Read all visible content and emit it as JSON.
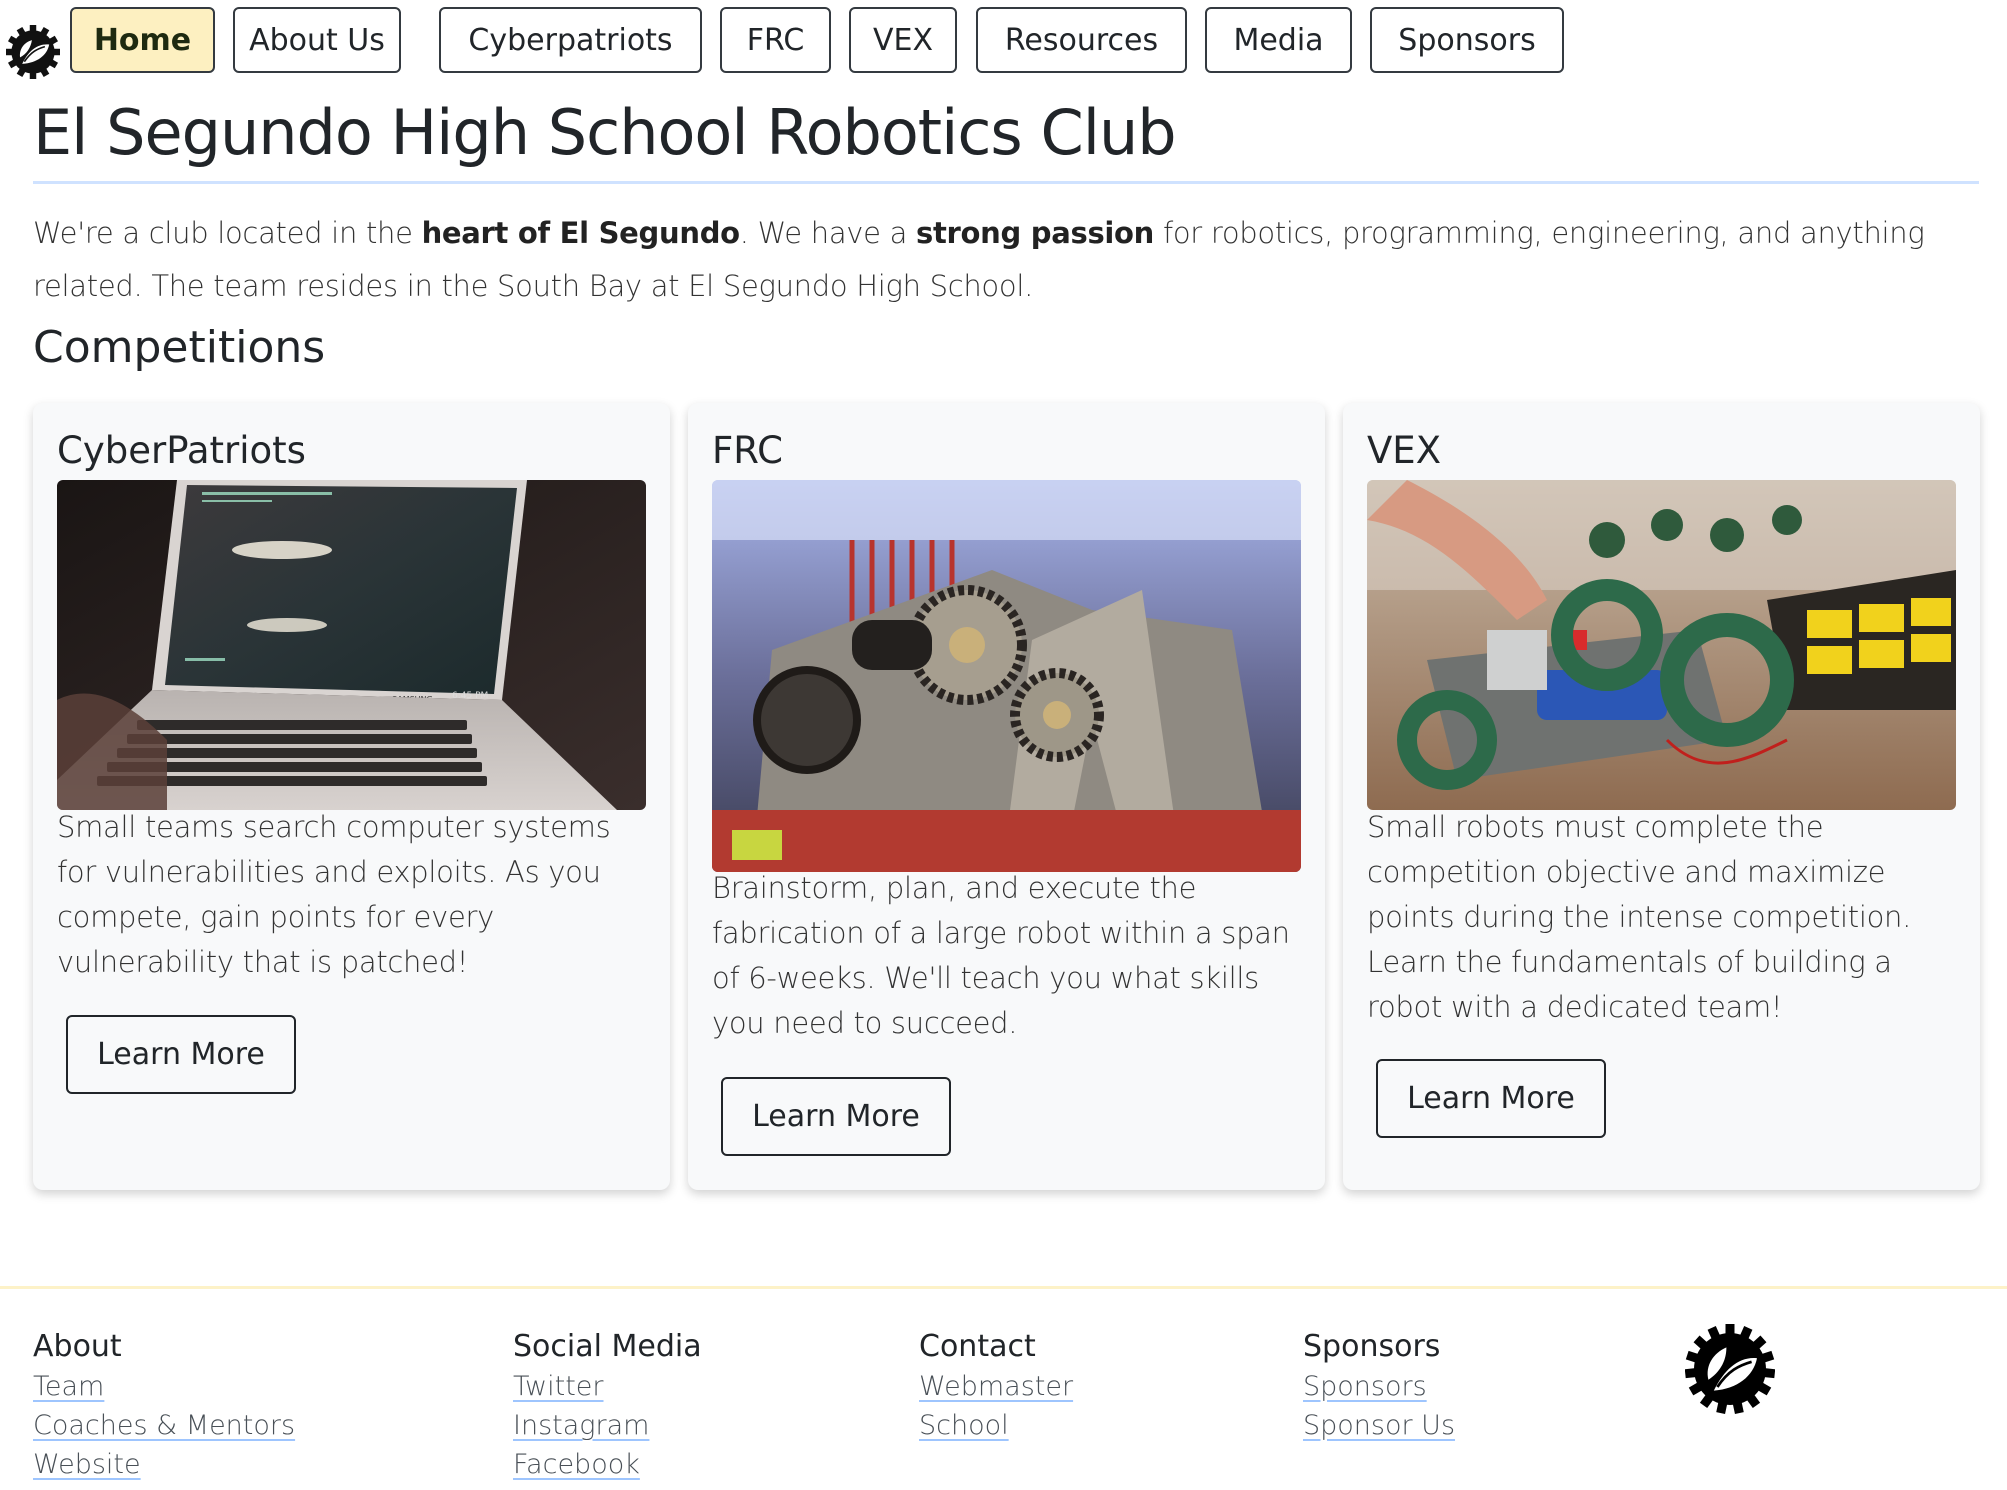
{
  "nav": {
    "logo_icon": "robotics-gear-leaf-logo-icon",
    "items": [
      {
        "label": "Home",
        "active": true
      },
      {
        "label": "About Us"
      },
      {
        "label": "Cyberpatriots"
      },
      {
        "label": "FRC"
      },
      {
        "label": "VEX"
      },
      {
        "label": "Resources"
      },
      {
        "label": "Media"
      },
      {
        "label": "Sponsors"
      }
    ]
  },
  "page": {
    "title": "El Segundo High School Robotics Club",
    "intro": {
      "p1": "We're a club located in the ",
      "b1": "heart of El Segundo",
      "p2": ". We have a ",
      "b2": "strong passion",
      "p3": " for robotics, programming, engineering, and anything related. The team resides in the South Bay at El Segundo High School."
    },
    "section_heading": "Competitions"
  },
  "cards": [
    {
      "title": "CyberPatriots",
      "image": "laptop-terminal-photo",
      "description": "Small teams search computer systems for vulnerabilities and exploits. As you compete, gain points for every vulnerability that is patched!",
      "button": "Learn More",
      "laptop_brand": "SAMSUNG",
      "screen_time": "6:45 PM"
    },
    {
      "title": "FRC",
      "image": "frc-robot-gears-photo",
      "description": "Brainstorm, plan, and execute the fabrication of a large robot within a span of 6-weeks. We'll teach you what skills you need to succeed.",
      "button": "Learn More"
    },
    {
      "title": "VEX",
      "image": "vex-robot-build-photo",
      "description": "Small robots must complete the competition objective and maximize points during the intense competition. Learn the fundamentals of building a robot with a dedicated team!",
      "button": "Learn More"
    }
  ],
  "footer": {
    "columns": [
      {
        "heading": "About",
        "links": [
          "Team",
          "Coaches & Mentors",
          "Website"
        ]
      },
      {
        "heading": "Social Media",
        "links": [
          "Twitter",
          "Instagram",
          "Facebook"
        ]
      },
      {
        "heading": "Contact",
        "links": [
          "Webmaster",
          "School"
        ]
      },
      {
        "heading": "Sponsors",
        "links": [
          "Sponsors",
          "Sponsor Us"
        ]
      }
    ],
    "logo_icon": "robotics-gear-leaf-logo-icon"
  },
  "colors": {
    "active_nav_bg": "#fdf0c1",
    "title_rule": "#cfe2ff",
    "footer_rule": "#fdf2c8",
    "card_bg": "#f8f9fa",
    "text": "#212529"
  }
}
